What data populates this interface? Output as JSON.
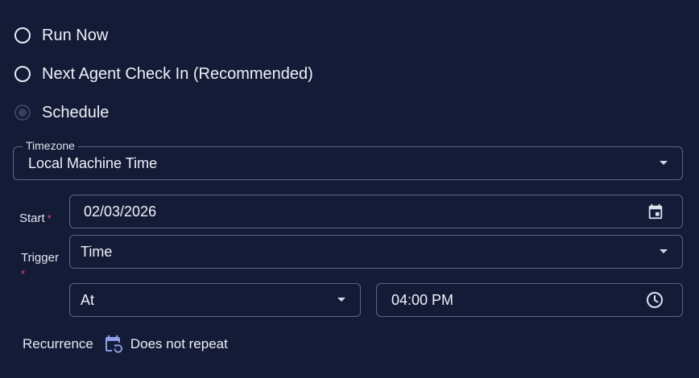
{
  "run_options": [
    {
      "label": "Run Now",
      "selected": false
    },
    {
      "label": "Next Agent Check In (Recommended)",
      "selected": false
    },
    {
      "label": "Schedule",
      "selected": true
    }
  ],
  "timezone": {
    "legend": "Timezone",
    "value": "Local Machine Time",
    "icon": "chevron-down-icon"
  },
  "start": {
    "label": "Start",
    "required_mark": "*",
    "value": "02/03/2026",
    "icon": "calendar-icon"
  },
  "trigger": {
    "label": "Trigger",
    "required_mark": "*",
    "value": "Time",
    "icon": "chevron-down-icon"
  },
  "at_select": {
    "value": "At",
    "icon": "chevron-down-icon"
  },
  "time_field": {
    "value": "04:00 PM",
    "icon": "clock-icon"
  },
  "recurrence": {
    "label": "Recurrence",
    "value": "Does not repeat",
    "icon": "calendar-repeat-icon"
  },
  "colors": {
    "background": "#141b37",
    "border": "#5e6582",
    "required": "#e24d6b",
    "recurrence_icon": "#8d9fe6"
  }
}
